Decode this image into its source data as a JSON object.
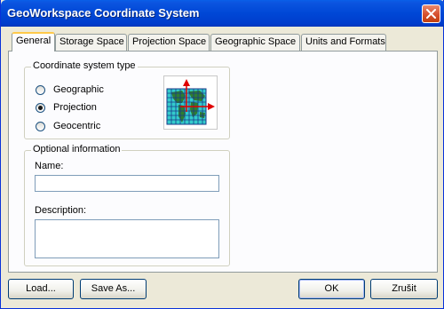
{
  "window": {
    "title": "GeoWorkspace Coordinate System"
  },
  "tabs": [
    {
      "label": "General",
      "active": true
    },
    {
      "label": "Storage Space",
      "active": false
    },
    {
      "label": "Projection Space",
      "active": false
    },
    {
      "label": "Geographic Space",
      "active": false
    },
    {
      "label": "Units and Formats",
      "active": false
    }
  ],
  "coordinate_type": {
    "group_label": "Coordinate system type",
    "options": [
      {
        "label": "Geographic",
        "checked": false
      },
      {
        "label": "Projection",
        "checked": true
      },
      {
        "label": "Geocentric",
        "checked": false
      }
    ],
    "preview_icon": "projection-map-icon"
  },
  "optional_info": {
    "group_label": "Optional information",
    "name_label": "Name:",
    "name_value": "",
    "description_label": "Description:",
    "description_value": ""
  },
  "buttons": {
    "load": "Load...",
    "save_as": "Save As...",
    "ok": "OK",
    "cancel": "Zrušit"
  },
  "colors": {
    "titlebar": "#0047d6",
    "tab_highlight": "#ffc94a",
    "map_water": "#33cccc",
    "map_land": "#2e7d32",
    "axis_arrow": "#e00000"
  }
}
